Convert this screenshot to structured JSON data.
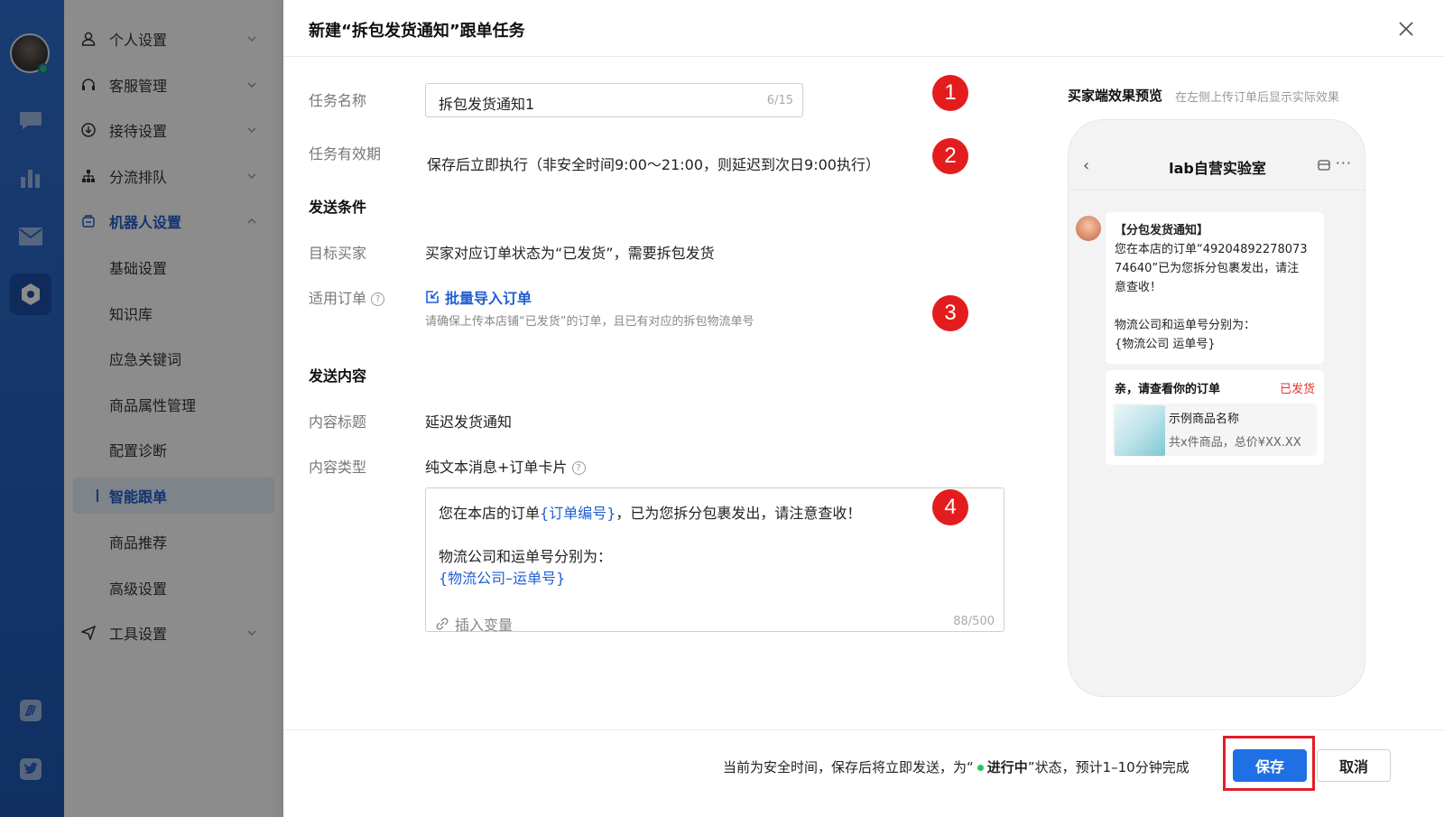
{
  "rail": {
    "icons": [
      "avatar",
      "chat-icon",
      "chart-icon",
      "mail-icon",
      "robot-settings-icon",
      "app-icon",
      "twitter-icon"
    ]
  },
  "sidebar": {
    "items": [
      {
        "label": "个人设置",
        "icon": "user-icon"
      },
      {
        "label": "客服管理",
        "icon": "headset-icon"
      },
      {
        "label": "接待设置",
        "icon": "download-icon"
      },
      {
        "label": "分流排队",
        "icon": "org-icon"
      },
      {
        "label": "机器人设置",
        "icon": "robot-icon"
      },
      {
        "label": "基础设置"
      },
      {
        "label": "知识库"
      },
      {
        "label": "应急关键词"
      },
      {
        "label": "商品属性管理"
      },
      {
        "label": "配置诊断"
      },
      {
        "label": "智能跟单"
      },
      {
        "label": "商品推荐"
      },
      {
        "label": "高级设置"
      },
      {
        "label": "工具设置",
        "icon": "send-icon"
      }
    ]
  },
  "drawer": {
    "title": "新建“拆包发货通知”跟单任务",
    "task_name_label": "任务名称",
    "task_name_value": "拆包发货通知1",
    "task_name_count": "6/15",
    "validity_label": "任务有效期",
    "validity_value": "保存后立即执行（非安全时间9:00～21:00，则延迟到次日9:00执行）",
    "send_condition_title": "发送条件",
    "target_buyer_label": "目标买家",
    "target_buyer_value": "买家对应订单状态为“已发货”，需要拆包发货",
    "order_label": "适用订单",
    "import_link": "批量导入订单",
    "import_hint": "请确保上传本店铺“已发货”的订单，且已有对应的拆包物流单号",
    "send_content_title": "发送内容",
    "content_title_label": "内容标题",
    "content_title_value": "延迟发货通知",
    "content_type_label": "内容类型",
    "content_type_value": "纯文本消息+订单卡片",
    "content_line1_a": "您在本店的订单",
    "content_line1_var": "{订单编号}",
    "content_line1_b": "，已为您拆分包裹发出，请注意查收！",
    "content_line2": "物流公司和运单号分别为：",
    "content_line3": "{物流公司–运单号}",
    "insert_variable": "插入变量",
    "content_count": "88/500",
    "markers": [
      "1",
      "2",
      "3",
      "4"
    ]
  },
  "preview": {
    "title": "买家端效果预览",
    "subtitle": "在左侧上传订单后显示实际效果",
    "back": "‹",
    "shop_name": "lab自营实验室",
    "more": "···",
    "bubble_title": "【分包发货通知】",
    "bubble_l1": "您在本店的订单“49204892278073",
    "bubble_l2": "74640”已为您拆分包裹发出，请注",
    "bubble_l3": "意查收！",
    "bubble_l4": "物流公司和运单号分别为：",
    "bubble_l5": "{物流公司 运单号}",
    "card_title": "亲，请查看你的订单",
    "card_status": "已发货",
    "product_name": "示例商品名称",
    "product_summary": "共x件商品，总价¥XX.XX"
  },
  "footer": {
    "msg_a": "当前为安全时间，保存后将立即发送，为“",
    "msg_b": "进行中",
    "msg_c": "”状态，预计1–10分钟完成",
    "save": "保存",
    "cancel": "取消"
  },
  "colors": {
    "primary": "#1f6fe5",
    "link": "#1f5fd1",
    "marker_red": "#e31d1d",
    "status_red": "#e3342f",
    "online_green": "#22c55e"
  }
}
